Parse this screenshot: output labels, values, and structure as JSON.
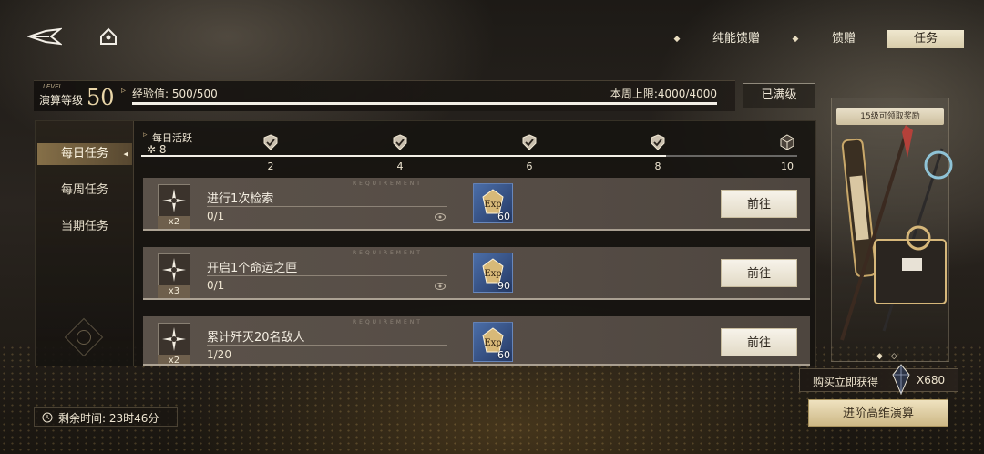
{
  "top_nav": {
    "tabs": [
      "纯能馈赠",
      "馈赠",
      "任务"
    ],
    "active_tab": "任务"
  },
  "level": {
    "small_title": "LEVEL",
    "label": "演算等级",
    "value": "50",
    "exp_label": "经验值: 500/500",
    "exp_fraction": 1.0,
    "weekly_cap_label": "本周上限:4000/4000",
    "maxed_button": "已满级"
  },
  "sidebar": {
    "items": [
      {
        "label": "每日任务",
        "active": true
      },
      {
        "label": "每周任务",
        "active": false
      },
      {
        "label": "当期任务",
        "active": false
      }
    ]
  },
  "daily_activity": {
    "label": "每日活跃",
    "value": "8",
    "max": 10,
    "milestones": [
      {
        "label": "2",
        "claimed": true
      },
      {
        "label": "4",
        "claimed": true
      },
      {
        "label": "6",
        "claimed": true
      },
      {
        "label": "8",
        "claimed": true
      },
      {
        "label": "10",
        "claimed": false
      }
    ]
  },
  "tasks": [
    {
      "title": "进行1次检索",
      "multiplier": "x2",
      "progress": "0/1",
      "reward": "60",
      "button": "前往",
      "req_text": "REQUIREMENT"
    },
    {
      "title": "开启1个命运之匣",
      "multiplier": "x3",
      "progress": "0/1",
      "reward": "90",
      "button": "前往",
      "req_text": "REQUIREMENT"
    },
    {
      "title": "累计歼灭20名敌人",
      "multiplier": "x2",
      "progress": "1/20",
      "reward": "60",
      "button": "前往",
      "req_text": "REQUIREMENT"
    }
  ],
  "promo": {
    "caption": "15级可领取奖励",
    "buy_label": "购买立即获得",
    "buy_amount": "X680",
    "advance_button": "进阶高维演算"
  },
  "timer": {
    "label": "剩余时间: 23时46分"
  },
  "colors": {
    "accent_gold": "#d8ccaa",
    "card_bg": "#5b524a",
    "panel_bg": "#16130f",
    "reward_blue": "#4b6ea8"
  }
}
